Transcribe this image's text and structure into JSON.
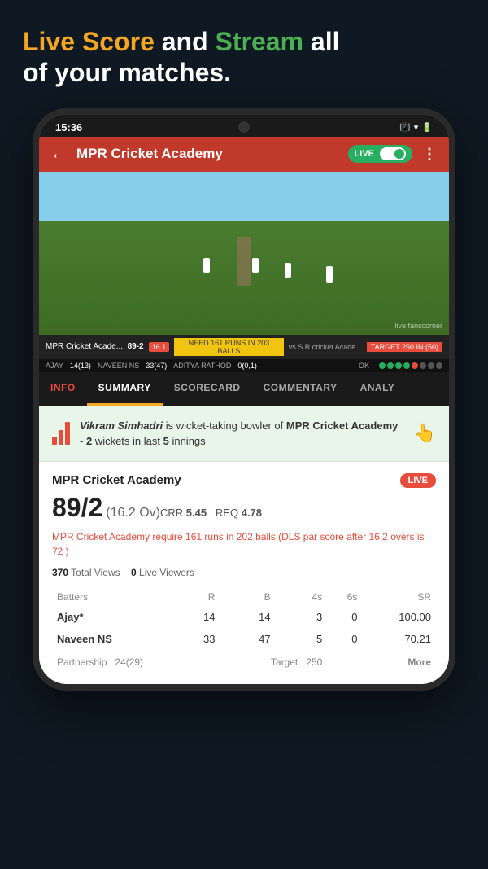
{
  "hero": {
    "line1_white": "Live Score",
    "line1_orange": " and ",
    "line1_green": "Stream",
    "line1_end": " all",
    "line2": "of your matches."
  },
  "status_bar": {
    "time": "15:36",
    "icons": "📳 ▾ 🔋"
  },
  "app_header": {
    "back": "←",
    "title": "MPR Cricket Academy",
    "live_label": "LIVE",
    "more": "⋮"
  },
  "score_overlay": {
    "team1": "MPR Cricket Acade...",
    "score": "89-2",
    "overs": "16.1",
    "need": "NEED 161 RUNS IN 203 BALLS",
    "vs": "vs S.R.cricket Acade...",
    "target": "TARGET 250 IN (50)"
  },
  "batters_overlay": {
    "batter1": "AJAY",
    "batter1_score": "14(13)",
    "batter2": "NAVEEN NS",
    "batter2_score": "33(47)",
    "bowler": "ADITYA RATHOD",
    "bowler_score": "0(0,1)",
    "ok": "OK"
  },
  "tabs": [
    {
      "label": "INFO",
      "active": false
    },
    {
      "label": "SUMMARY",
      "active": true
    },
    {
      "label": "SCORECARD",
      "active": false
    },
    {
      "label": "COMMENTARY",
      "active": false
    },
    {
      "label": "ANALY",
      "active": false
    }
  ],
  "highlight": {
    "text_italic": "Vikram Simhadri",
    "text1": " is wicket-taking bowler of ",
    "text_bold": "MPR Cricket Academy",
    "text2": " - ",
    "num1": "2",
    "text3": " wickets in last ",
    "num2": "5",
    "text4": " innings"
  },
  "match": {
    "team": "MPR Cricket Academy",
    "live": "LIVE",
    "score": "89/2",
    "overs": "(16.2 Ov)",
    "crr_label": "CRR",
    "crr_val": "5.45",
    "req_label": "REQ",
    "req_val": "4.78",
    "dls_text": "MPR Cricket Academy require 161 runs in 202 balls (DLS par score after 16.2 overs is 72 )",
    "views": "370",
    "views_label": "Total Views",
    "live_viewers": "0",
    "live_viewers_label": "Live Viewers"
  },
  "scorecard": {
    "headers": [
      "Batters",
      "R",
      "B",
      "4s",
      "6s",
      "SR"
    ],
    "rows": [
      {
        "name": "Ajay*",
        "r": "14",
        "b": "14",
        "fours": "3",
        "sixes": "0",
        "sr": "100.00",
        "green": true
      },
      {
        "name": "Naveen NS",
        "r": "33",
        "b": "47",
        "fours": "5",
        "sixes": "0",
        "sr": "70.21",
        "green": true
      }
    ],
    "footer": {
      "partnership": "Partnership",
      "p_val": "24(29)",
      "target": "Target",
      "t_val": "250",
      "more": "More"
    }
  }
}
